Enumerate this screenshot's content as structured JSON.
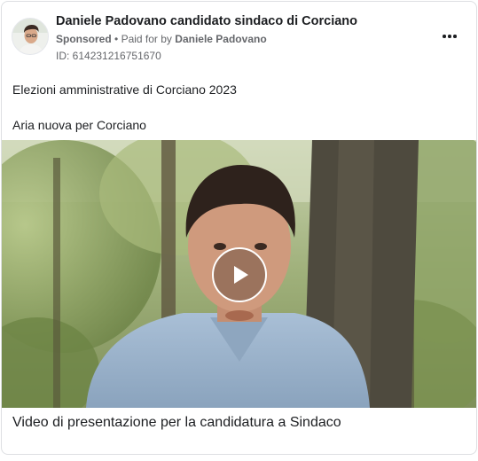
{
  "post": {
    "page_name": "Daniele Padovano candidato sindaco di Corciano",
    "sponsored_label": "Sponsored",
    "separator": "•",
    "paid_for_prefix": "Paid for by",
    "paid_for_by": "Daniele Padovano",
    "ad_id": "ID: 614231216751670",
    "more_icon": "more-horizontal-icon",
    "body_lines": [
      "Elezioni amministrative di Corciano 2023",
      "Aria nuova per Corciano"
    ]
  },
  "media": {
    "type": "video",
    "play_icon": "play-icon",
    "caption": "Video di presentazione per la candidatura a Sindaco"
  },
  "colors": {
    "text_primary": "#1c1e21",
    "text_secondary": "#65676b",
    "border": "#dddfe2",
    "play_overlay": "#ffffff"
  }
}
